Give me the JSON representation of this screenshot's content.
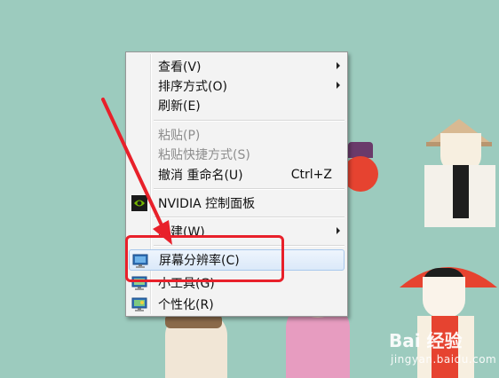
{
  "menu": {
    "items": [
      {
        "label": "查看(V)",
        "submenu": true
      },
      {
        "label": "排序方式(O)",
        "submenu": true
      },
      {
        "label": "刷新(E)"
      },
      {
        "label": "粘贴(P)",
        "disabled": true
      },
      {
        "label": "粘贴快捷方式(S)",
        "disabled": true
      },
      {
        "label": "撤消 重命名(U)",
        "shortcut": "Ctrl+Z"
      },
      {
        "label": "NVIDIA 控制面板",
        "icon": "nvidia-icon"
      },
      {
        "label": "新建(W)",
        "submenu": true
      },
      {
        "label": "屏幕分辨率(C)",
        "icon": "monitor-resolution-icon",
        "highlighted": true
      },
      {
        "label": "小工具(G)",
        "icon": "gadgets-icon"
      },
      {
        "label": "个性化(R)",
        "icon": "personalize-icon"
      }
    ]
  },
  "watermark": {
    "main": "Bai 经验",
    "sub": "jingyan.baidu.com"
  },
  "colors": {
    "desktop": "#9ccbbe",
    "highlight_box": "#e8202a",
    "arrow": "#e8202a"
  }
}
